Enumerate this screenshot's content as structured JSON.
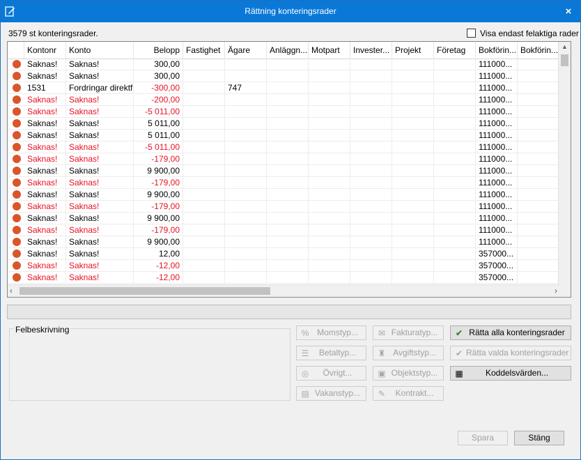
{
  "window": {
    "title": "Rättning konteringsrader",
    "close_label": "×"
  },
  "summary": {
    "count_text": "3579 st konteringsrader."
  },
  "filter": {
    "label": "Visa endast felaktiga rader",
    "checked": false
  },
  "grid": {
    "columns": [
      "",
      "Kontonr",
      "Konto",
      "Belopp",
      "Fastighet",
      "Ägare",
      "Anläggn...",
      "Motpart",
      "Invester...",
      "Projekt",
      "Företag",
      "Bokförin...",
      "Bokförin..."
    ],
    "rows": [
      {
        "error": false,
        "kontonr": "Saknas!",
        "konto": "Saknas!",
        "belopp": "300,00",
        "agare": "",
        "bokforing": "111000..."
      },
      {
        "error": false,
        "kontonr": "Saknas!",
        "konto": "Saknas!",
        "belopp": "300,00",
        "agare": "",
        "bokforing": "111000..."
      },
      {
        "error": false,
        "kontonr": "1531",
        "konto": "Fordringar direktf...",
        "belopp": "-300,00",
        "agare": "747",
        "bokforing": "111000...",
        "belopp_negative": true
      },
      {
        "error": true,
        "kontonr": "Saknas!",
        "konto": "Saknas!",
        "belopp": "-200,00",
        "agare": "",
        "bokforing": "111000..."
      },
      {
        "error": true,
        "kontonr": "Saknas!",
        "konto": "Saknas!",
        "belopp": "-5 011,00",
        "agare": "",
        "bokforing": "111000..."
      },
      {
        "error": false,
        "kontonr": "Saknas!",
        "konto": "Saknas!",
        "belopp": "5 011,00",
        "agare": "",
        "bokforing": "111000..."
      },
      {
        "error": false,
        "kontonr": "Saknas!",
        "konto": "Saknas!",
        "belopp": "5 011,00",
        "agare": "",
        "bokforing": "111000..."
      },
      {
        "error": true,
        "kontonr": "Saknas!",
        "konto": "Saknas!",
        "belopp": "-5 011,00",
        "agare": "",
        "bokforing": "111000..."
      },
      {
        "error": true,
        "kontonr": "Saknas!",
        "konto": "Saknas!",
        "belopp": "-179,00",
        "agare": "",
        "bokforing": "111000..."
      },
      {
        "error": false,
        "kontonr": "Saknas!",
        "konto": "Saknas!",
        "belopp": "9 900,00",
        "agare": "",
        "bokforing": "111000..."
      },
      {
        "error": true,
        "kontonr": "Saknas!",
        "konto": "Saknas!",
        "belopp": "-179,00",
        "agare": "",
        "bokforing": "111000..."
      },
      {
        "error": false,
        "kontonr": "Saknas!",
        "konto": "Saknas!",
        "belopp": "9 900,00",
        "agare": "",
        "bokforing": "111000..."
      },
      {
        "error": true,
        "kontonr": "Saknas!",
        "konto": "Saknas!",
        "belopp": "-179,00",
        "agare": "",
        "bokforing": "111000..."
      },
      {
        "error": false,
        "kontonr": "Saknas!",
        "konto": "Saknas!",
        "belopp": "9 900,00",
        "agare": "",
        "bokforing": "111000..."
      },
      {
        "error": true,
        "kontonr": "Saknas!",
        "konto": "Saknas!",
        "belopp": "-179,00",
        "agare": "",
        "bokforing": "111000..."
      },
      {
        "error": false,
        "kontonr": "Saknas!",
        "konto": "Saknas!",
        "belopp": "9 900,00",
        "agare": "",
        "bokforing": "111000..."
      },
      {
        "error": false,
        "kontonr": "Saknas!",
        "konto": "Saknas!",
        "belopp": "12,00",
        "agare": "",
        "bokforing": "357000..."
      },
      {
        "error": true,
        "kontonr": "Saknas!",
        "konto": "Saknas!",
        "belopp": "-12,00",
        "agare": "",
        "bokforing": "357000..."
      },
      {
        "error": true,
        "kontonr": "Saknas!",
        "konto": "Saknas!",
        "belopp": "-12,00",
        "agare": "",
        "bokforing": "357000..."
      }
    ]
  },
  "error_panel": {
    "label": "Felbeskrivning"
  },
  "buttons": {
    "momstyp": "Momstyp...",
    "fakturatyp": "Fakturatyp...",
    "ratta_alla": "Rätta alla konteringsrader",
    "betaltyp": "Betaltyp...",
    "avgiftstyp": "Avgiftstyp...",
    "ratta_valda": "Rätta valda konteringsrader",
    "ovrigt": "Övrigt...",
    "objektstyp": "Objektstyp...",
    "koddelsvarden": "Koddelsvärden...",
    "vakanstyp": "Vakanstyp...",
    "kontrakt": "Kontrakt...",
    "spara": "Spara",
    "stang": "Stäng"
  },
  "colors": {
    "titlebar": "#0a78d7",
    "error_text": "#e81123",
    "status_dot": "#d9562c"
  }
}
